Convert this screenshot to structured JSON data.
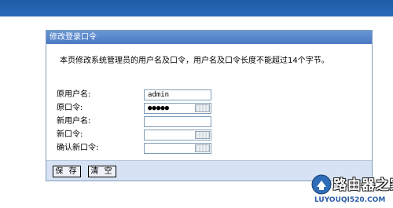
{
  "panel": {
    "title": "修改登录口令",
    "description": "本页修改系统管理员的用户名及口令，用户名及口令长度不能超过14个字节。"
  },
  "form": {
    "old_username_label": "原用户名:",
    "old_username_value": "admin",
    "old_password_label": "原口令:",
    "old_password_value": "●●●●●",
    "new_username_label": "新用户名:",
    "new_username_value": "",
    "new_password_label": "新口令:",
    "new_password_value": "",
    "confirm_password_label": "确认新口令:",
    "confirm_password_value": ""
  },
  "buttons": {
    "save_label": "保 存",
    "clear_label": "清 空"
  },
  "watermark": {
    "title": "路由器之家",
    "url": "LUYOUQI520.COM"
  },
  "colors": {
    "header_blue": "#4a79c2",
    "top_bar_blue": "#2a6ab8",
    "footer_bg": "#d7e3f4"
  }
}
